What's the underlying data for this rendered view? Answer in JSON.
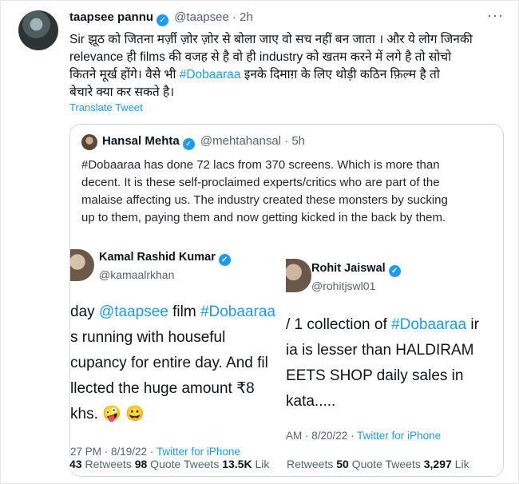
{
  "tweet": {
    "author_name": "taapsee pannu",
    "author_handle": "@taapsee",
    "dot": "·",
    "time": "2h",
    "more": "···",
    "text_lines": [
      "Sir झूठ को जितना मर्ज़ी ज़ोर ज़ोर से बोला जाए वो सच नहीं बन जाता । और ये लोग जिनकी",
      "relevance ही films की वजह से है वो ही industry को खतम करने में लगे है तो सोचो",
      "कितने मूर्ख होंगे। वैसे भी "
    ],
    "hashtag": "#Dobaaraa",
    "text_after_hashtag": " इनके दिमाग़ के लिए थोड़ी कठिन फ़िल्म है तो",
    "text_last_line": "बेचारे क्या कर सकते है।",
    "translate_label": "Translate Tweet"
  },
  "quote": {
    "author_name": "Hansal Mehta",
    "author_handle": "@mehtahansal",
    "dot": "·",
    "time": "5h",
    "text_lines": [
      "#Dobaaraa has done 72 lacs from 370 screens. Which is more than",
      "decent. It is these self-proclaimed experts/critics who are part of the",
      "malaise affecting us. The industry created these monsters by sucking",
      "up to them, paying them and now getting kicked in the back by them."
    ]
  },
  "screenshot1": {
    "name": "Kamal Rashid Kumar",
    "handle": "@kamaalrkhan",
    "lines": [
      "day @taapsee film #Dobaaraa",
      "s running with houseful",
      "cupancy for entire day. And fil",
      "llected the huge amount ₹8",
      "khs. 🤪 😀"
    ],
    "meta_time": "27 PM · 8/19/22 · ",
    "meta_source": "Twitter for iPhone",
    "stats": [
      "43",
      " Retweets  ",
      "98",
      " Quote Tweets  ",
      "13.5K",
      " Lik"
    ]
  },
  "screenshot2": {
    "name": "Rohit Jaiswal",
    "handle": "@rohitjswl01",
    "line1_pre": "/ 1 collection of ",
    "line1_tag": "#Dobaaraa",
    "line1_post": " ir",
    "lines": [
      "ia is lesser than HALDIRAM",
      "EETS SHOP daily sales in",
      "kata....."
    ],
    "meta_time": " AM · 8/20/22 · ",
    "meta_source": "Twitter for iPhone",
    "stats": [
      "Retweets  ",
      "50",
      " Quote Tweets  ",
      "3,297",
      " Lik"
    ]
  },
  "colors": {
    "link": "#1d9bf0",
    "verified": "#1d9bf0",
    "muted": "#536471"
  }
}
